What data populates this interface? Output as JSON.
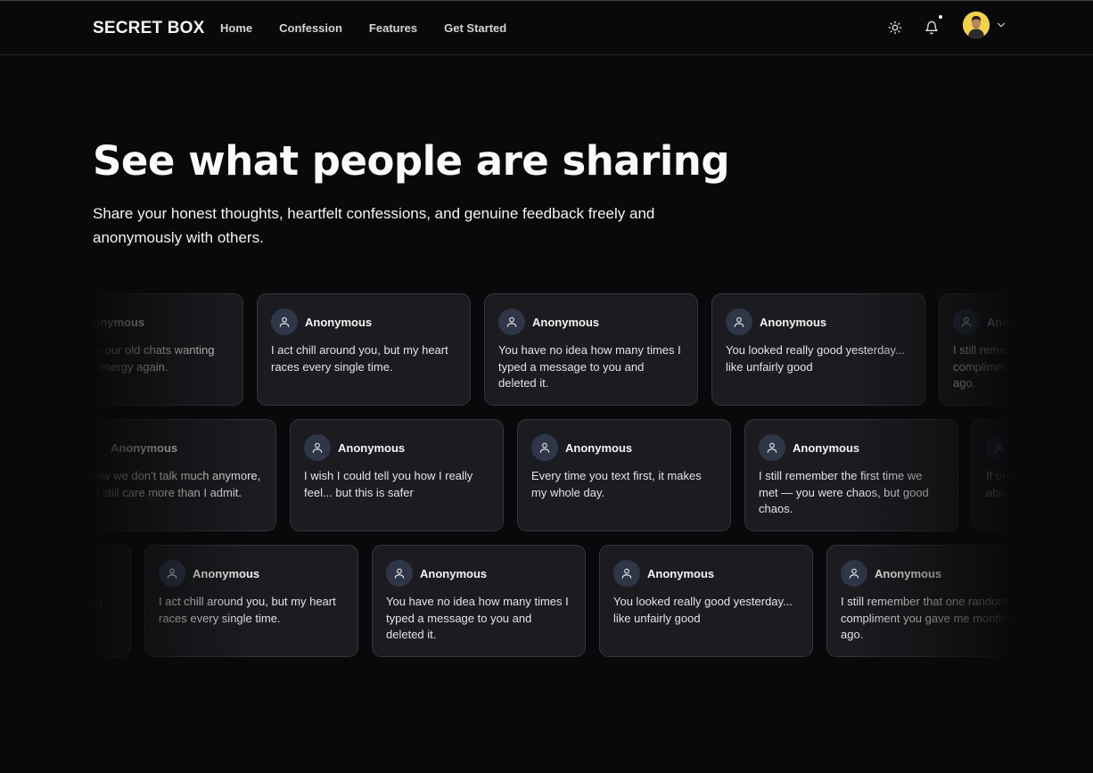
{
  "brand": "SECRET BOX",
  "nav": {
    "links": [
      "Home",
      "Confession",
      "Features",
      "Get Started"
    ]
  },
  "header_icons": [
    "sun-icon",
    "bell-icon",
    "avatar",
    "chevron-down-icon"
  ],
  "hero": {
    "title": "See what people are sharing",
    "subtitle": "Share your honest thoughts, heartfelt confessions, and genuine feedback freely and anonymously with others."
  },
  "rows": [
    {
      "cards": [
        {
          "name": "Anonymous",
          "text": "I still replay our old chats wanting that same energy again."
        },
        {
          "name": "Anonymous",
          "text": "I act chill around you, but my heart races every single time."
        },
        {
          "name": "Anonymous",
          "text": "You have no idea how many times I typed a message to you and deleted it."
        },
        {
          "name": "Anonymous",
          "text": "You looked really good yesterday... like unfairly good"
        },
        {
          "name": "Anonymous",
          "text": "I still remember that one random compliment you gave me months ago."
        }
      ]
    },
    {
      "cards": [
        {
          "name": "Anonymous",
          "text": "I know we don't talk much anymore, but I still care more than I admit."
        },
        {
          "name": "Anonymous",
          "text": "I wish I could tell you how I really feel... but this is safer"
        },
        {
          "name": "Anonymous",
          "text": "Every time you text first, it makes my whole day."
        },
        {
          "name": "Anonymous",
          "text": "I still remember the first time we met — you were chaos, but good chaos."
        },
        {
          "name": "Anonymous",
          "text": "If only you knew how often I think about you when I hear your name."
        }
      ]
    },
    {
      "cards": [
        {
          "name": "Anonymous",
          "text": "I still replay our old chats wanting that same energy again."
        },
        {
          "name": "Anonymous",
          "text": "I act chill around you, but my heart races every single time."
        },
        {
          "name": "Anonymous",
          "text": "You have no idea how many times I typed a message to you and deleted it."
        },
        {
          "name": "Anonymous",
          "text": "You looked really good yesterday... like unfairly good"
        },
        {
          "name": "Anonymous",
          "text": "I still remember that one random compliment you gave me months ago."
        }
      ]
    }
  ],
  "colors": {
    "background": "#09090b",
    "card_bg": "#1c1c20",
    "card_border": "#34343a",
    "avatar_bg": "#2e3648",
    "text": "#fafafa"
  }
}
